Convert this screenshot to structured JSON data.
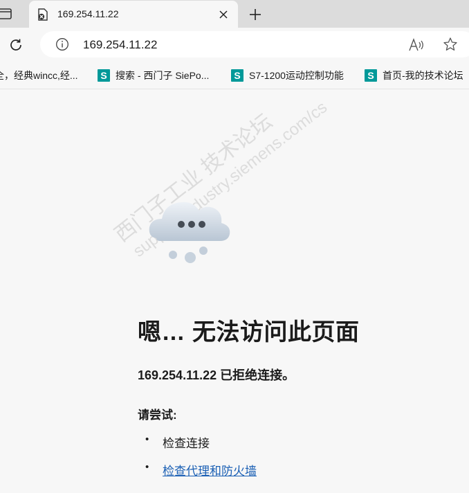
{
  "tab": {
    "title": "169.254.11.22",
    "close_icon": "close-icon",
    "favicon": "broken-page-icon"
  },
  "toolbar": {
    "url": "169.254.11.22",
    "refresh_icon": "refresh-icon",
    "info_icon": "info-icon",
    "read_aloud_icon": "read-aloud-icon",
    "favorite_icon": "star-icon"
  },
  "bookmarks": [
    {
      "label": "全，经典wincc,经..."
    },
    {
      "label": "搜索 - 西门子 SiePo..."
    },
    {
      "label": "S7-1200运动控制功能"
    },
    {
      "label": "首页-我的技术论坛"
    }
  ],
  "watermark": {
    "line1": "西门子工业   技术论坛",
    "line2": "support.industry.siemens.com/cs"
  },
  "error": {
    "heading": "嗯… 无法访问此页面",
    "message": "169.254.11.22 已拒绝连接。",
    "try_label": "请尝试:",
    "suggestions": [
      {
        "text": "检查连接",
        "is_link": false
      },
      {
        "text": "检查代理和防火墙",
        "is_link": true
      }
    ]
  },
  "colors": {
    "accent_siemens": "#009999",
    "link": "#1a5fb4",
    "tabstrip_bg": "#dcdcdc",
    "page_bg": "#f7f7f7"
  }
}
